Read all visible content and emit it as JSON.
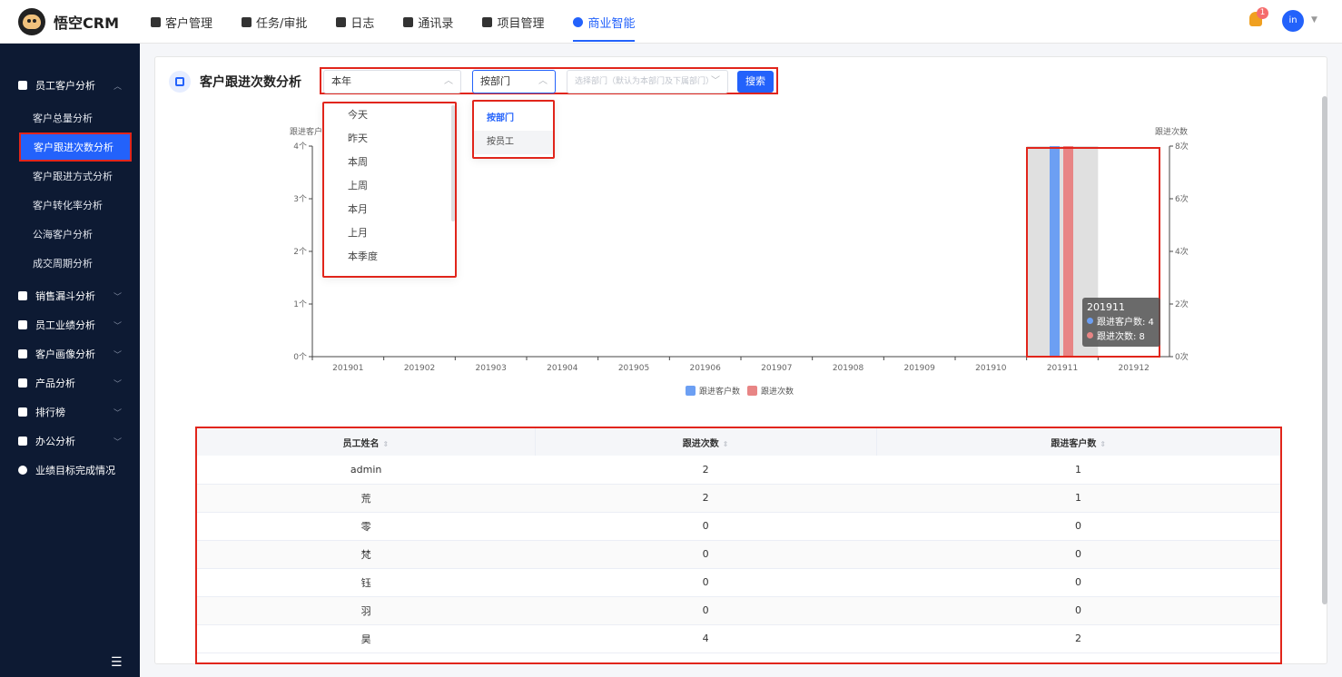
{
  "app": {
    "logo_text": "悟空CRM"
  },
  "topnav": [
    {
      "label": "客户管理",
      "active": false
    },
    {
      "label": "任务/审批",
      "active": false
    },
    {
      "label": "日志",
      "active": false
    },
    {
      "label": "通讯录",
      "active": false
    },
    {
      "label": "项目管理",
      "active": false
    },
    {
      "label": "商业智能",
      "active": true
    }
  ],
  "notifications": {
    "badge": "1"
  },
  "user": {
    "avatar_text": "in"
  },
  "sidebar": {
    "groups": [
      {
        "label": "员工客户分析",
        "expanded": true
      },
      {
        "label": "销售漏斗分析"
      },
      {
        "label": "员工业绩分析"
      },
      {
        "label": "客户画像分析"
      },
      {
        "label": "产品分析"
      },
      {
        "label": "排行榜"
      },
      {
        "label": "办公分析"
      },
      {
        "label": "业绩目标完成情况"
      }
    ],
    "subitems": [
      {
        "label": "客户总量分析",
        "active": false
      },
      {
        "label": "客户跟进次数分析",
        "active": true
      },
      {
        "label": "客户跟进方式分析",
        "active": false
      },
      {
        "label": "客户转化率分析",
        "active": false
      },
      {
        "label": "公海客户分析",
        "active": false
      },
      {
        "label": "成交周期分析",
        "active": false
      }
    ]
  },
  "page": {
    "title": "客户跟进次数分析"
  },
  "filters": {
    "time_value": "本年",
    "type_value": "按部门",
    "dept_placeholder": "选择部门（默认为本部门及下属部门）",
    "search_label": "搜索",
    "time_options": [
      "今天",
      "昨天",
      "本周",
      "上周",
      "本月",
      "上月",
      "本季度"
    ],
    "type_options": [
      "按部门",
      "按员工"
    ]
  },
  "tooltip": {
    "title": "201911",
    "rows": [
      {
        "label": "跟进客户数: 4",
        "color": "#6c9ff3"
      },
      {
        "label": "跟进次数: 8",
        "color": "#e88585"
      }
    ]
  },
  "chart_data": {
    "type": "bar",
    "categories": [
      "201901",
      "201902",
      "201903",
      "201904",
      "201905",
      "201906",
      "201907",
      "201908",
      "201909",
      "201910",
      "201911",
      "201912"
    ],
    "series": [
      {
        "name": "跟进客户数",
        "axis": "left",
        "color": "#6c9ff3",
        "values": [
          0,
          0,
          0,
          0,
          0,
          0,
          0,
          0,
          0,
          0,
          4,
          0
        ]
      },
      {
        "name": "跟进次数",
        "axis": "right",
        "color": "#e88585",
        "values": [
          0,
          0,
          0,
          0,
          0,
          0,
          0,
          0,
          0,
          0,
          8,
          0
        ]
      }
    ],
    "ylabel_left": "跟进客户",
    "ylabel_right": "跟进次数",
    "yticks_left": [
      "0个",
      "1个",
      "2个",
      "3个",
      "4个"
    ],
    "yticks_right": [
      "0次",
      "2次",
      "4次",
      "6次",
      "8次"
    ],
    "ylim_left": [
      0,
      4
    ],
    "ylim_right": [
      0,
      8
    ],
    "highlighted_category": "201911",
    "legend": [
      "跟进客户数",
      "跟进次数"
    ]
  },
  "table": {
    "columns": [
      "员工姓名",
      "跟进次数",
      "跟进客户数"
    ],
    "rows": [
      [
        "admin",
        "2",
        "1"
      ],
      [
        "荒",
        "2",
        "1"
      ],
      [
        "零",
        "0",
        "0"
      ],
      [
        "梵",
        "0",
        "0"
      ],
      [
        "钰",
        "0",
        "0"
      ],
      [
        "羽",
        "0",
        "0"
      ],
      [
        "昊",
        "4",
        "2"
      ]
    ]
  }
}
